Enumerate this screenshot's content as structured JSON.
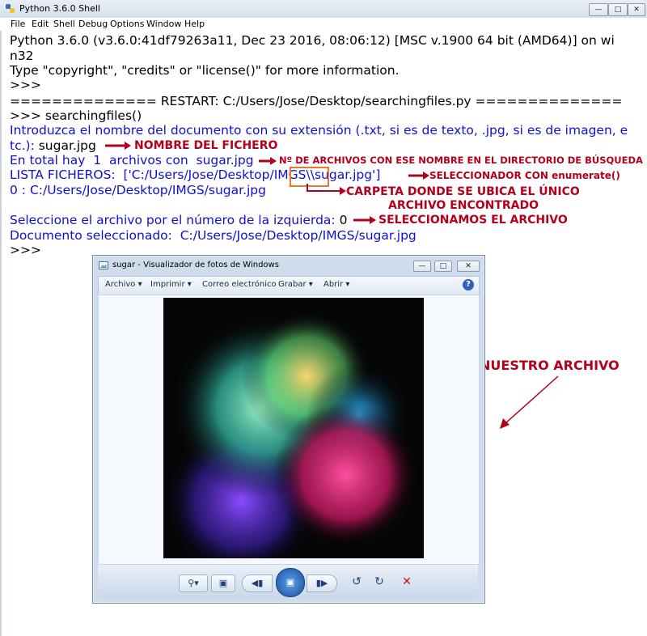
{
  "window": {
    "title": "Python 3.6.0 Shell",
    "menu": [
      "File",
      "Edit",
      "Shell",
      "Debug",
      "Options",
      "Window",
      "Help"
    ],
    "controls": [
      "minimize",
      "maximize",
      "close"
    ]
  },
  "shell": {
    "line1": "Python 3.6.0 (v3.6.0:41df79263a11, Dec 23 2016, 08:06:12) [MSC v.1900 64 bit (AMD64)] on wi",
    "line2": "n32",
    "line3": "Type \"copyright\", \"credits\" or \"license()\" for more information.",
    "prompt1": ">>>",
    "restart": "============== RESTART: C:/Users/Jose/Desktop/searchingfiles.py ==============",
    "call": ">>> searchingfiles()",
    "ask1": "Introduzca el nombre del documento con su extensión (.txt, si es de texto, .jpg, si es de imagen, e",
    "ask2_prefix": "tc.): ",
    "ask2_input": "sugar.jpg",
    "total": "En total hay  1  archivos con  sugar.jpg",
    "lista_prefix": "LISTA FICHEROS:  ['C:/Users/Jose/Desktop/",
    "lista_imgs": "IMGS",
    "lista_suffix": "\\\\sugar.jpg']",
    "item0": "0 : C:/Users/Jose/Desktop/IMGS/sugar.jpg",
    "select_prefix": "Seleccione el archivo por el número de la izquierda: ",
    "select_input": "0",
    "selected": "Documento seleccionado:  C:/Users/Jose/Desktop/IMGS/sugar.jpg",
    "prompt2": ">>>"
  },
  "annotations": {
    "nombre": "NOMBRE DEL FICHERO",
    "num_archivos": "Nº DE ARCHIVOS CON ESE NOMBRE EN EL DIRECTORIO DE BÚSQUEDA",
    "seleccionador": "SELECCIONADOR CON enumerate()",
    "carpeta1": "CARPETA DONDE SE UBICA EL ÚNICO",
    "carpeta2": "ARCHIVO ENCONTRADO",
    "seleccionamos": "SELECCIONAMOS EL ARCHIVO",
    "nuestro": "NUESTRO ARCHIVO",
    "color": "#b3001b"
  },
  "viewer": {
    "title": "sugar - Visualizador de fotos de Windows",
    "menu": [
      "Archivo",
      "Imprimir",
      "Correo electrónico",
      "Grabar",
      "Abrir"
    ],
    "help": "?"
  }
}
